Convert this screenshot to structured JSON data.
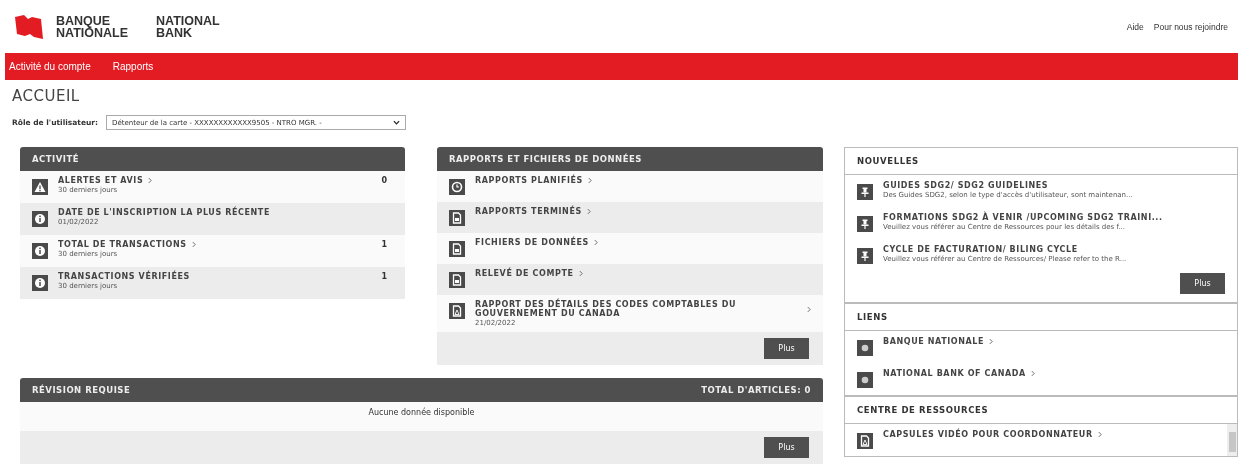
{
  "logo": {
    "fr": [
      "BANQUE",
      "NATIONALE"
    ],
    "en": [
      "NATIONAL",
      "BANK"
    ]
  },
  "top_links": [
    "Aide",
    "Pour nous rejoindre"
  ],
  "nav": [
    {
      "label": "Activité du compte",
      "selected": false
    },
    {
      "label": "Rapports",
      "selected": false
    }
  ],
  "page_title": "ACCUEIL",
  "role": {
    "label": "Rôle de l'utilisateur:",
    "value": "Détenteur de la carte - XXXXXXXXXXXX9505 - NTRO MGR. -"
  },
  "activity": {
    "title": "ACTIVITÉ",
    "items": [
      {
        "kind": "warning",
        "title": "ALERTES ET AVIS",
        "arrow": true,
        "sub": "30 derniers jours",
        "count": "0"
      },
      {
        "kind": "info",
        "title": "DATE DE L'INSCRIPTION LA PLUS RÉCENTE",
        "arrow": false,
        "sub": "01/02/2022"
      },
      {
        "kind": "info",
        "title": "TOTAL DE TRANSACTIONS",
        "arrow": true,
        "sub": "30 derniers jours",
        "count": "1"
      },
      {
        "kind": "info",
        "title": "TRANSACTIONS VÉRIFIÉES",
        "arrow": false,
        "sub": "30 derniers jours",
        "count": "1"
      }
    ]
  },
  "reports": {
    "title": "RAPPORTS ET FICHIERS DE DONNÉES",
    "items": [
      {
        "kind": "clock",
        "title": "RAPPORTS PLANIFIÉS",
        "arrow": true
      },
      {
        "kind": "doc",
        "title": "RAPPORTS TERMINÉS",
        "arrow": true
      },
      {
        "kind": "doc",
        "title": "FICHIERS DE DONNÉES",
        "arrow": true
      },
      {
        "kind": "doc",
        "title": "RELEVÉ DE COMPTE",
        "arrow": true
      },
      {
        "kind": "pdf",
        "title": "RAPPORT DES DÉTAILS DES CODES COMPTABLES DU GOUVERNEMENT DU CANADA",
        "arrow": true,
        "sub": "21/02/2022"
      }
    ],
    "button": "Plus"
  },
  "review": {
    "title": "RÉVISION REQUISE",
    "total": "TOTAL D'ARTICLES: 0",
    "empty": "Aucune donnée disponible",
    "button": "Plus"
  },
  "news": {
    "title": "NOUVELLES",
    "items": [
      {
        "kind": "pin",
        "title": "GUIDES SDG2/ SDG2 GUIDELINES",
        "sub": "Des Guides SDG2, selon le type d'accès d'utilisateur, sont maintenan..."
      },
      {
        "kind": "pin",
        "title": "FORMATIONS SDG2 À VENIR /UPCOMING SDG2 TRAINI...",
        "sub": "Veuillez vous référer au Centre de Ressources pour les détails des f..."
      },
      {
        "kind": "pin",
        "title": "CYCLE DE FACTURATION/ BILING CYCLE",
        "sub": "Veuillez vous référer au Centre de Ressources/ Please refer to the R..."
      }
    ],
    "button": "Plus"
  },
  "links": {
    "title": "LIENS",
    "items": [
      {
        "kind": "link",
        "title": "BANQUE NATIONALE",
        "arrow": true
      },
      {
        "kind": "link",
        "title": "NATIONAL BANK OF CANADA",
        "arrow": true
      }
    ]
  },
  "resources": {
    "title": "CENTRE DE RESSOURCES",
    "items": [
      {
        "kind": "pdf",
        "title": "CAPSULES VIDÉO POUR COORDONNATEUR",
        "arrow": true
      }
    ]
  }
}
